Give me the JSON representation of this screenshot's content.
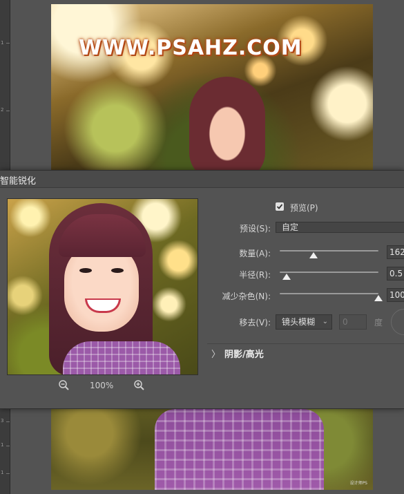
{
  "canvas": {
    "watermark_logo": "WWW.PSAHZ.COM",
    "ruler_ticks": [
      "1",
      "2",
      "3",
      "1",
      "1"
    ],
    "small_watermark": "设计师PS"
  },
  "dialog": {
    "title": "智能锐化",
    "preview_checkbox": {
      "label": "预览(P)",
      "checked": true
    },
    "preset": {
      "label": "预设(S):",
      "value": "自定"
    },
    "amount": {
      "label": "数量(A):",
      "value": "162",
      "fraction": 0.34
    },
    "radius": {
      "label": "半径(R):",
      "value": "0.5",
      "fraction": 0.07
    },
    "reduce_noise": {
      "label": "减少杂色(N):",
      "value": "100",
      "fraction": 1.0
    },
    "remove": {
      "label": "移去(V):",
      "value": "镜头模糊",
      "angle_value": "0",
      "angle_unit": "度"
    },
    "shadow_highlight": {
      "label": "阴影/高光",
      "chevron": "〉"
    },
    "zoom": {
      "level": "100%"
    }
  },
  "colors": {
    "panel_bg": "#535353",
    "titlebar_bg": "#4a4a4a",
    "field_bg": "#454545",
    "text": "#d6d6d6"
  },
  "icons": [
    "zoom-out-icon",
    "zoom-in-icon",
    "checkmark-icon",
    "chevron-right-icon",
    "chevron-down-icon",
    "angle-dial-icon"
  ]
}
